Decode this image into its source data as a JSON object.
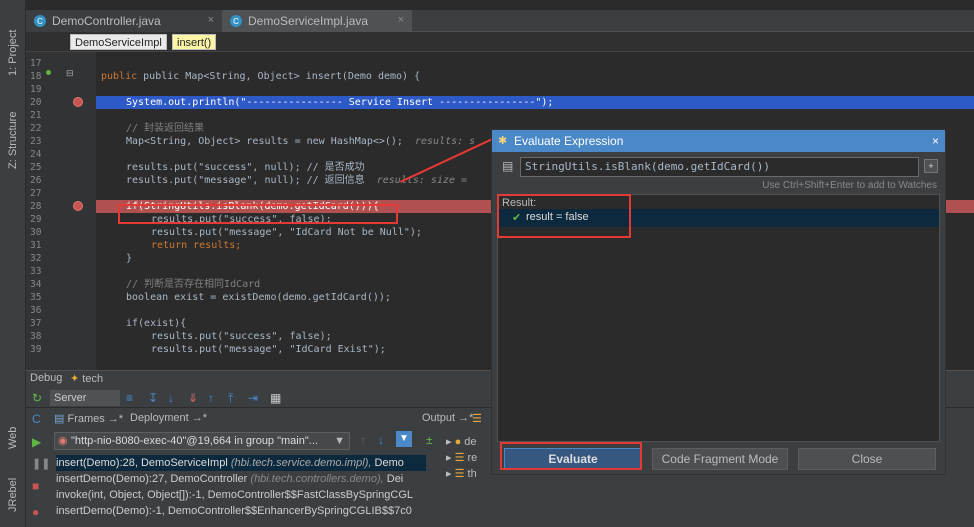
{
  "left_strip": {
    "project": "1: Project",
    "structure": "Z: Structure",
    "web": "Web",
    "jrebel": "JRebel"
  },
  "tabs": [
    {
      "label": "DemoController.java",
      "active": false
    },
    {
      "label": "DemoServiceImpl.java",
      "active": true
    }
  ],
  "breadcrumb": {
    "class": "DemoServiceImpl",
    "method": "insert()"
  },
  "lines": [
    "17",
    "18",
    "19",
    "20",
    "21",
    "22",
    "23",
    "24",
    "25",
    "26",
    "27",
    "28",
    "29",
    "30",
    "31",
    "32",
    "33",
    "34",
    "35",
    "36",
    "37",
    "38",
    "39"
  ],
  "code": {
    "l18": "public Map<String, Object> insert(Demo demo) {",
    "l20": "System.out.println(\"---------------- Service Insert ----------------\");",
    "l22": "// 封装返回结果",
    "l23a": "Map<String, Object> results = new HashMap<>();",
    "l23b": "results: s",
    "l25": "results.put(\"success\", null); // 是否成功",
    "l26a": "results.put(\"message\", null); // 返回信息",
    "l26b": "results: size =",
    "l28": "if(StringUtils.isBlank(demo.getIdCard())){",
    "l29": "results.put(\"success\", false);",
    "l30": "results.put(\"message\", \"IdCard Not be Null\");",
    "l31": "return results;",
    "l32": "}",
    "l34": "// 判断是否存在相同IdCard",
    "l35": "boolean exist = existDemo(demo.getIdCard());",
    "l37": "if(exist){",
    "l38": "results.put(\"success\", false);",
    "l39": "results.put(\"message\", \"IdCard Exist\");"
  },
  "dialog": {
    "title": "Evaluate Expression",
    "close": "×",
    "expression": "StringUtils.isBlank(demo.getIdCard())",
    "hint": "Use Ctrl+Shift+Enter to add to Watches",
    "result_label": "Result:",
    "result_value": "result = false",
    "buttons": {
      "evaluate": "Evaluate",
      "fragment": "Code Fragment Mode",
      "close": "Close"
    }
  },
  "debug": {
    "title": "Debug",
    "config": "tech",
    "server": "Server",
    "frames_tab": "Frames →*",
    "deployment_tab": "Deployment →*",
    "output_tab": "Output →*",
    "thread": "\"http-nio-8080-exec-40\"@19,664 in group \"main\"...",
    "frames": [
      {
        "method": "insert(Demo):28, DemoServiceImpl",
        "pkg": "(hbi.tech.service.demo.impl),",
        "tail": "Demo"
      },
      {
        "method": "insertDemo(Demo):27, DemoController",
        "pkg": "(hbi.tech.controllers.demo),",
        "tail": "Dei"
      },
      {
        "method": "invoke(int, Object, Object[]):-1, DemoController$$FastClassBySpringCGL",
        "pkg": "",
        "tail": ""
      },
      {
        "method": "insertDemo(Demo):-1, DemoController$$EnhancerBySpringCGLIB$$7c0",
        "pkg": "",
        "tail": ""
      }
    ],
    "vars": [
      "de",
      "re",
      "th"
    ]
  }
}
